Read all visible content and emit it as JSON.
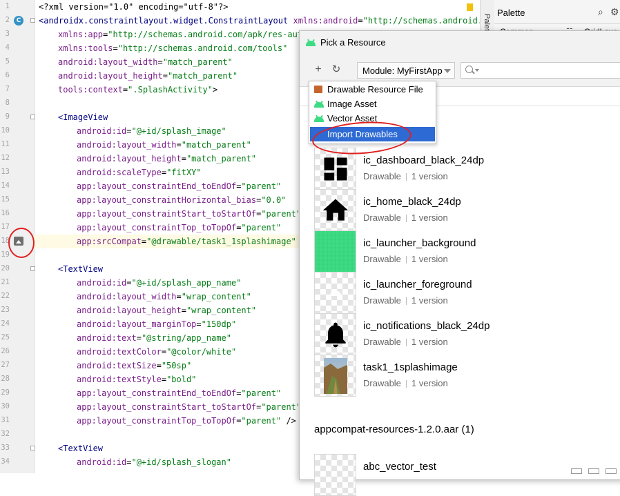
{
  "editor": {
    "lines": [
      {
        "n": "1",
        "parts": [
          [
            "pi",
            "<?xml version=\"1.0\" encoding=\"utf-8\"?>"
          ]
        ],
        "indent": 0
      },
      {
        "n": "2",
        "parts": [
          [
            "tag",
            "<androidx.constraintlayout.widget.ConstraintLayout "
          ],
          [
            "attr",
            "xmlns:android"
          ],
          [
            "pi",
            "="
          ],
          [
            "val",
            "\"http://schemas.android.co"
          ]
        ],
        "indent": 0
      },
      {
        "n": "3",
        "parts": [
          [
            "attr",
            "xmlns:app"
          ],
          [
            "pi",
            "="
          ],
          [
            "val",
            "\"http://schemas.android.com/apk/res-auto"
          ]
        ],
        "indent": 1
      },
      {
        "n": "4",
        "parts": [
          [
            "attr",
            "xmlns:tools"
          ],
          [
            "pi",
            "="
          ],
          [
            "val",
            "\"http://schemas.android.com/tools\""
          ]
        ],
        "indent": 1
      },
      {
        "n": "5",
        "parts": [
          [
            "attr",
            "android:layout_width"
          ],
          [
            "pi",
            "="
          ],
          [
            "val",
            "\"match_parent\""
          ]
        ],
        "indent": 1
      },
      {
        "n": "6",
        "parts": [
          [
            "attr",
            "android:layout_height"
          ],
          [
            "pi",
            "="
          ],
          [
            "val",
            "\"match_parent\""
          ]
        ],
        "indent": 1
      },
      {
        "n": "7",
        "parts": [
          [
            "attr",
            "tools:context"
          ],
          [
            "pi",
            "="
          ],
          [
            "val",
            "\".SplashActivity\""
          ],
          [
            "pi",
            ">"
          ]
        ],
        "indent": 1
      },
      {
        "n": "8",
        "parts": [],
        "indent": 0
      },
      {
        "n": "9",
        "parts": [
          [
            "tag",
            "<ImageView"
          ]
        ],
        "indent": 1
      },
      {
        "n": "10",
        "parts": [
          [
            "attr",
            "android:id"
          ],
          [
            "pi",
            "="
          ],
          [
            "val",
            "\"@+id/splash_image\""
          ]
        ],
        "indent": 2
      },
      {
        "n": "11",
        "parts": [
          [
            "attr",
            "android:layout_width"
          ],
          [
            "pi",
            "="
          ],
          [
            "val",
            "\"match_parent\""
          ]
        ],
        "indent": 2
      },
      {
        "n": "12",
        "parts": [
          [
            "attr",
            "android:layout_height"
          ],
          [
            "pi",
            "="
          ],
          [
            "val",
            "\"match_parent\""
          ]
        ],
        "indent": 2
      },
      {
        "n": "13",
        "parts": [
          [
            "attr",
            "android:scaleType"
          ],
          [
            "pi",
            "="
          ],
          [
            "val",
            "\"fitXY\""
          ]
        ],
        "indent": 2
      },
      {
        "n": "14",
        "parts": [
          [
            "attr",
            "app:layout_constraintEnd_toEndOf"
          ],
          [
            "pi",
            "="
          ],
          [
            "val",
            "\"parent\""
          ]
        ],
        "indent": 2
      },
      {
        "n": "15",
        "parts": [
          [
            "attr",
            "app:layout_constraintHorizontal_bias"
          ],
          [
            "pi",
            "="
          ],
          [
            "val",
            "\"0.0\""
          ]
        ],
        "indent": 2
      },
      {
        "n": "16",
        "parts": [
          [
            "attr",
            "app:layout_constraintStart_toStartOf"
          ],
          [
            "pi",
            "="
          ],
          [
            "val",
            "\"parent\""
          ]
        ],
        "indent": 2
      },
      {
        "n": "17",
        "parts": [
          [
            "attr",
            "app:layout_constraintTop_toTopOf"
          ],
          [
            "pi",
            "="
          ],
          [
            "val",
            "\"parent\""
          ]
        ],
        "indent": 2
      },
      {
        "n": "18",
        "parts": [
          [
            "attr",
            "app:srcCompat"
          ],
          [
            "pi",
            "="
          ],
          [
            "val",
            "\"@drawable/task1_1splashimage\""
          ],
          [
            "pi",
            " /"
          ]
        ],
        "indent": 2
      },
      {
        "n": "19",
        "parts": [],
        "indent": 0
      },
      {
        "n": "20",
        "parts": [
          [
            "tag",
            "<TextView"
          ]
        ],
        "indent": 1
      },
      {
        "n": "21",
        "parts": [
          [
            "attr",
            "android:id"
          ],
          [
            "pi",
            "="
          ],
          [
            "val",
            "\"@+id/splash_app_name\""
          ]
        ],
        "indent": 2
      },
      {
        "n": "22",
        "parts": [
          [
            "attr",
            "android:layout_width"
          ],
          [
            "pi",
            "="
          ],
          [
            "val",
            "\"wrap_content\""
          ]
        ],
        "indent": 2
      },
      {
        "n": "23",
        "parts": [
          [
            "attr",
            "android:layout_height"
          ],
          [
            "pi",
            "="
          ],
          [
            "val",
            "\"wrap_content\""
          ]
        ],
        "indent": 2
      },
      {
        "n": "24",
        "parts": [
          [
            "attr",
            "android:layout_marginTop"
          ],
          [
            "pi",
            "="
          ],
          [
            "val",
            "\"150dp\""
          ]
        ],
        "indent": 2
      },
      {
        "n": "25",
        "parts": [
          [
            "attr",
            "android:text"
          ],
          [
            "pi",
            "="
          ],
          [
            "val",
            "\"@string/app_name\""
          ]
        ],
        "indent": 2
      },
      {
        "n": "26",
        "parts": [
          [
            "attr",
            "android:textColor"
          ],
          [
            "pi",
            "="
          ],
          [
            "val",
            "\"@color/white\""
          ]
        ],
        "indent": 2
      },
      {
        "n": "27",
        "parts": [
          [
            "attr",
            "android:textSize"
          ],
          [
            "pi",
            "="
          ],
          [
            "val",
            "\"50sp\""
          ]
        ],
        "indent": 2
      },
      {
        "n": "28",
        "parts": [
          [
            "attr",
            "android:textStyle"
          ],
          [
            "pi",
            "="
          ],
          [
            "val",
            "\"bold\""
          ]
        ],
        "indent": 2
      },
      {
        "n": "29",
        "parts": [
          [
            "attr",
            "app:layout_constraintEnd_toEndOf"
          ],
          [
            "pi",
            "="
          ],
          [
            "val",
            "\"parent\""
          ]
        ],
        "indent": 2
      },
      {
        "n": "30",
        "parts": [
          [
            "attr",
            "app:layout_constraintStart_toStartOf"
          ],
          [
            "pi",
            "="
          ],
          [
            "val",
            "\"parent\""
          ]
        ],
        "indent": 2
      },
      {
        "n": "31",
        "parts": [
          [
            "attr",
            "app:layout_constraintTop_toTopOf"
          ],
          [
            "pi",
            "="
          ],
          [
            "val",
            "\"parent\""
          ],
          [
            "pi",
            " />"
          ]
        ],
        "indent": 2
      },
      {
        "n": "32",
        "parts": [],
        "indent": 0
      },
      {
        "n": "33",
        "parts": [
          [
            "tag",
            "<TextView"
          ]
        ],
        "indent": 1
      },
      {
        "n": "34",
        "parts": [
          [
            "attr",
            "android:id"
          ],
          [
            "pi",
            "="
          ],
          [
            "val",
            "\"@+id/splash_slogan\""
          ]
        ],
        "indent": 2
      }
    ],
    "gutter_badge": "C"
  },
  "side_strip": {
    "label": "Palette"
  },
  "palette": {
    "title": "Palette",
    "row_left": "Common",
    "row_right": "GridLayo"
  },
  "dialog": {
    "title": "Pick a Resource",
    "module_label": "Module: MyFirstApp",
    "search_placeholder": "",
    "menu_items": [
      {
        "label": "Drawable Resource File",
        "icon": "drawable-file-icon"
      },
      {
        "label": "Image Asset",
        "icon": "android-icon"
      },
      {
        "label": "Vector Asset",
        "icon": "android-icon"
      },
      {
        "label": "Import Drawables",
        "icon": "none",
        "selected": true
      }
    ],
    "resources": [
      {
        "name": "ic_dashboard_black_24dp",
        "type": "Drawable",
        "versions": "1 version",
        "icon": "dashboard-icon"
      },
      {
        "name": "ic_home_black_24dp",
        "type": "Drawable",
        "versions": "1 version",
        "icon": "home-icon"
      },
      {
        "name": "ic_launcher_background",
        "type": "Drawable",
        "versions": "1 version",
        "icon": "launcher-background-icon"
      },
      {
        "name": "ic_launcher_foreground",
        "type": "Drawable",
        "versions": "1 version",
        "icon": "launcher-foreground-icon"
      },
      {
        "name": "ic_notifications_black_24dp",
        "type": "Drawable",
        "versions": "1 version",
        "icon": "bell-icon"
      },
      {
        "name": "task1_1splashimage",
        "type": "Drawable",
        "versions": "1 version",
        "icon": "photo-thumbnail"
      }
    ],
    "section_title": "appcompat-resources-1.2.0.aar (1)",
    "partial_item": "abc_vector_test"
  },
  "colors": {
    "accent": "#2e6ad3",
    "annotation": "#e02020",
    "launcher_green": "#3ddc84"
  }
}
